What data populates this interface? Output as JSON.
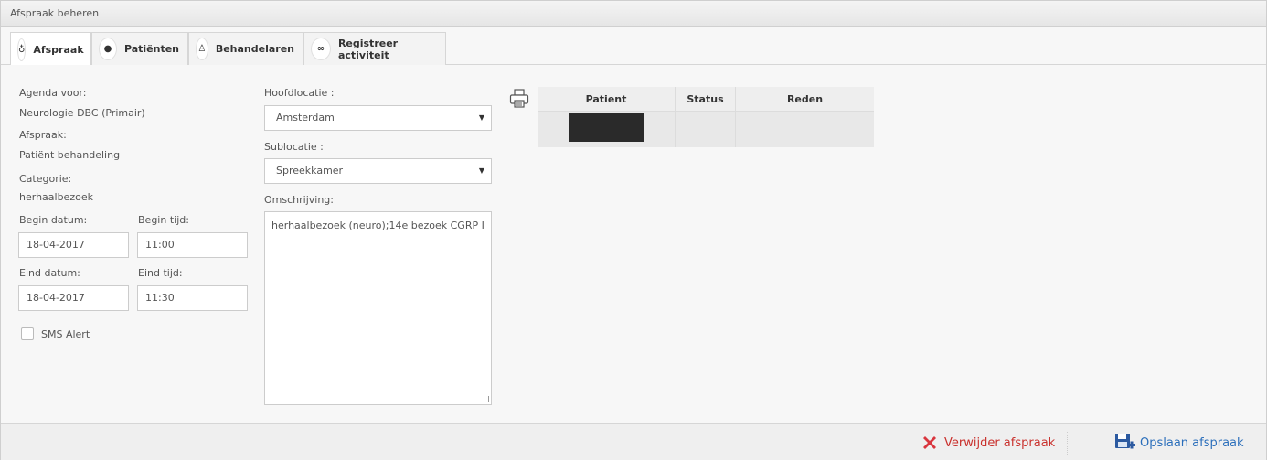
{
  "window": {
    "title": "Afspraak beheren"
  },
  "tabs": [
    {
      "label": "Afspraak",
      "icon": "stethoscope-icon",
      "glyph": "⚕",
      "active": true
    },
    {
      "label": "Patiënten",
      "icon": "user-icon",
      "glyph": "👤",
      "active": false
    },
    {
      "label": "Behandelaren",
      "icon": "doctor-icon",
      "glyph": "👨‍⚕",
      "active": false
    },
    {
      "label": "Registreer activiteit",
      "icon": "link-icon",
      "glyph": "🔗",
      "active": false
    }
  ],
  "form": {
    "agenda_label": "Agenda voor:",
    "agenda_value": "Neurologie DBC (Primair)",
    "afspraak_label": "Afspraak:",
    "afspraak_value": "Patiënt behandeling",
    "categorie_label": "Categorie:",
    "categorie_value": "herhaalbezoek",
    "begin_datum_label": "Begin datum:",
    "begin_datum_value": "18-04-2017",
    "begin_tijd_label": "Begin tijd:",
    "begin_tijd_value": "11:00",
    "eind_datum_label": "Eind datum:",
    "eind_datum_value": "18-04-2017",
    "eind_tijd_label": "Eind tijd:",
    "eind_tijd_value": "11:30",
    "sms_label": "SMS Alert",
    "sms_checked": false,
    "hoofdlocatie_label": "Hoofdlocatie :",
    "hoofdlocatie_value": "Amsterdam",
    "sublocatie_label": "Sublocatie :",
    "sublocatie_value": "Spreekkamer",
    "omschrijving_label": "Omschrijving:",
    "omschrijving_value": "herhaalbezoek (neuro);14e bezoek CGRP I"
  },
  "patient_table": {
    "columns": [
      "Patient",
      "Status",
      "Reden"
    ],
    "print_icon": "printer-icon"
  },
  "footer": {
    "delete_label": "Verwijder afspraak",
    "save_label": "Opslaan afspraak",
    "delete_color": "#c9302c",
    "save_color": "#2a6ebb"
  }
}
